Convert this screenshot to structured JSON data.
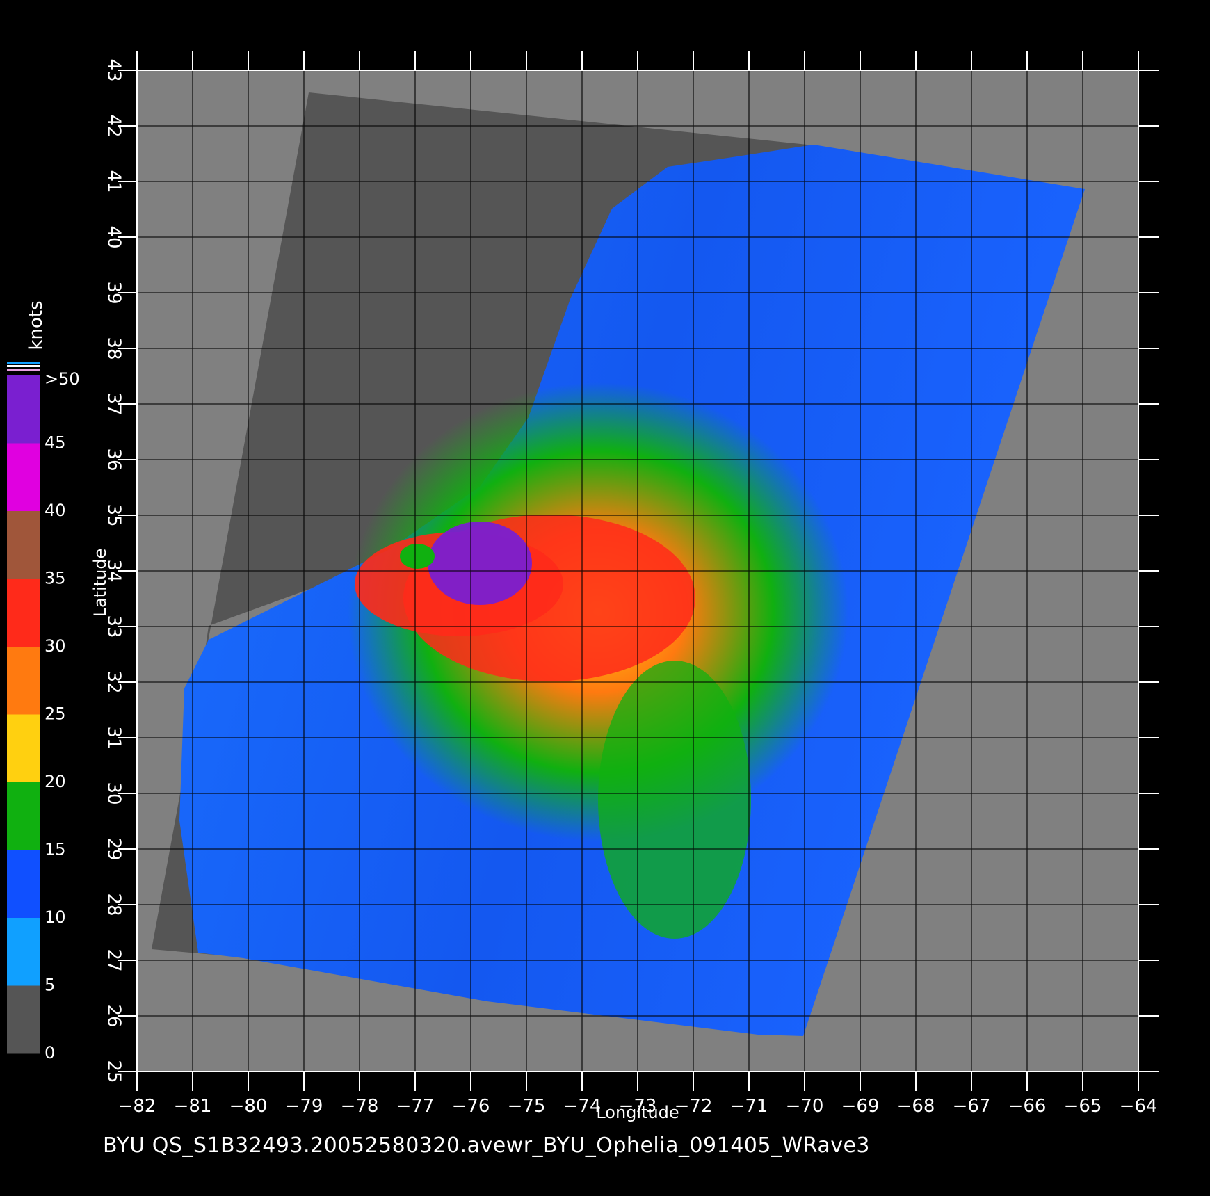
{
  "map": {
    "lon_range": [
      -82,
      -64
    ],
    "lat_range": [
      25,
      43
    ],
    "x_ticks": [
      -82,
      -81,
      -80,
      -79,
      -78,
      -77,
      -76,
      -75,
      -74,
      -73,
      -72,
      -71,
      -70,
      -69,
      -68,
      -67,
      -66,
      -65,
      -64
    ],
    "y_ticks": [
      25,
      26,
      27,
      28,
      29,
      30,
      31,
      32,
      33,
      34,
      35,
      36,
      37,
      38,
      39,
      40,
      41,
      42,
      43
    ],
    "xlabel": "Longitude",
    "ylabel": "Latitude",
    "background_color": "#000000",
    "land_color": "#555555",
    "nodata_color": "#808080"
  },
  "colorbar": {
    "title": "knots",
    "labels": [
      ">50",
      "45",
      "40",
      "35",
      "30",
      "25",
      "20",
      "15",
      "10",
      "5",
      "0"
    ],
    "bands": [
      {
        "range": [
          45,
          50
        ],
        "color": "#7a1fd0"
      },
      {
        "range": [
          40,
          45
        ],
        "color": "#e000e0"
      },
      {
        "range": [
          35,
          40
        ],
        "color": "#a0563a"
      },
      {
        "range": [
          30,
          35
        ],
        "color": "#ff2a1a"
      },
      {
        "range": [
          25,
          30
        ],
        "color": "#ff7a10"
      },
      {
        "range": [
          20,
          25
        ],
        "color": "#ffd010"
      },
      {
        "range": [
          15,
          20
        ],
        "color": "#10b010"
      },
      {
        "range": [
          10,
          15
        ],
        "color": "#1050ff"
      },
      {
        "range": [
          5,
          10
        ],
        "color": "#10a0ff"
      },
      {
        "range": [
          0,
          5
        ],
        "color": "#555555"
      }
    ]
  },
  "caption": "BYU  QS_S1B32493.20052580320.avewr_BYU_Ophelia_091405_WRave3"
}
